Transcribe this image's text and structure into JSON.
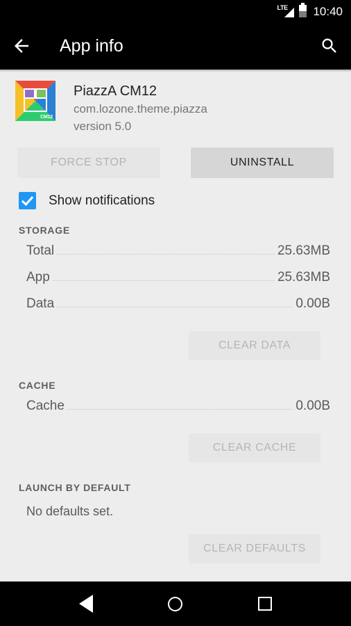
{
  "status_bar": {
    "network_label": "LTE",
    "network_icon": "signal-triangle-icon",
    "battery_icon": "battery-icon",
    "time": "10:40"
  },
  "action_bar": {
    "back_icon": "arrow-left-icon",
    "title": "App info",
    "search_icon": "search-icon"
  },
  "app": {
    "icon_label": "CM12",
    "name": "PiazzA CM12",
    "package": "com.lozone.theme.piazza",
    "version": "version 5.0"
  },
  "buttons": {
    "force_stop": "FORCE STOP",
    "uninstall": "UNINSTALL"
  },
  "notifications": {
    "label": "Show notifications",
    "checked": "true"
  },
  "storage": {
    "header": "STORAGE",
    "rows": [
      {
        "label": "Total",
        "value": "25.63MB"
      },
      {
        "label": "App",
        "value": "25.63MB"
      },
      {
        "label": "Data",
        "value": "0.00B"
      }
    ],
    "clear_button": "CLEAR DATA"
  },
  "cache": {
    "header": "CACHE",
    "rows": [
      {
        "label": "Cache",
        "value": "0.00B"
      }
    ],
    "clear_button": "CLEAR CACHE"
  },
  "launch_by_default": {
    "header": "LAUNCH BY DEFAULT",
    "text": "No defaults set.",
    "clear_button": "CLEAR DEFAULTS"
  },
  "nav_bar": {
    "back_icon": "nav-back-triangle-icon",
    "home_icon": "nav-home-circle-icon",
    "recents_icon": "nav-recents-square-icon"
  },
  "colors": {
    "accent": "#2196f3",
    "background": "#ededed",
    "bar": "#000000"
  }
}
